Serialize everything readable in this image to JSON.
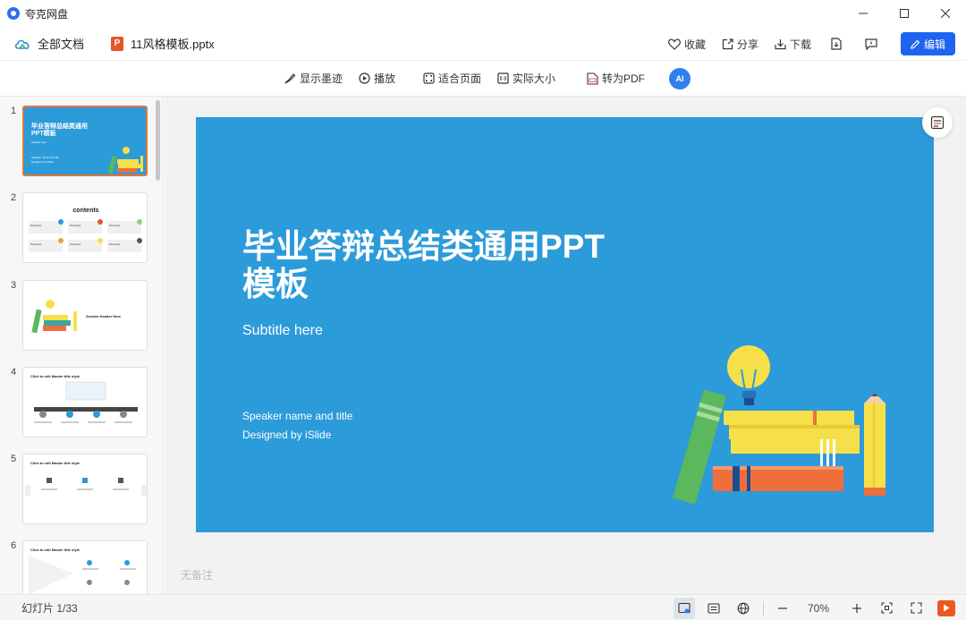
{
  "app": {
    "title": "夸克网盘"
  },
  "header": {
    "all_docs": "全部文档",
    "file_icon_letter": "P",
    "file_name": "11风格模板.pptx",
    "favorite": "收藏",
    "share": "分享",
    "download": "下载",
    "edit": "编辑"
  },
  "toolbar": {
    "show_ink": "显示墨迹",
    "play": "播放",
    "fit_page": "适合页面",
    "actual_size": "实际大小",
    "to_pdf": "转为PDF",
    "ai_label": "AI"
  },
  "thumbnails": {
    "numbers": [
      "1",
      "2",
      "3",
      "4",
      "5",
      "6"
    ],
    "t1_title": "毕业答辩总结类通用PPT模板",
    "t1_sub": "Subtitle here",
    "t1_speaker": "Speaker name and title",
    "t1_designer": "Designed by iSlide",
    "t2_title": "contents",
    "t2_item": "Text here",
    "t3_title": "Section Header Here",
    "master_title": "Click to edit Master title style"
  },
  "slide": {
    "title": "毕业答辩总结类通用PPT模板",
    "subtitle": "Subtitle here",
    "speaker": "Speaker name and title",
    "designer": "Designed by iSlide"
  },
  "notes": "无备注",
  "status": {
    "slide_count": "幻灯片 1/33",
    "zoom": "70%"
  },
  "colors": {
    "slide_bg": "#2c9bd9",
    "accent": "#1f64ef",
    "thumb_active_border": "#e0763b",
    "file_icon": "#e5552a"
  }
}
